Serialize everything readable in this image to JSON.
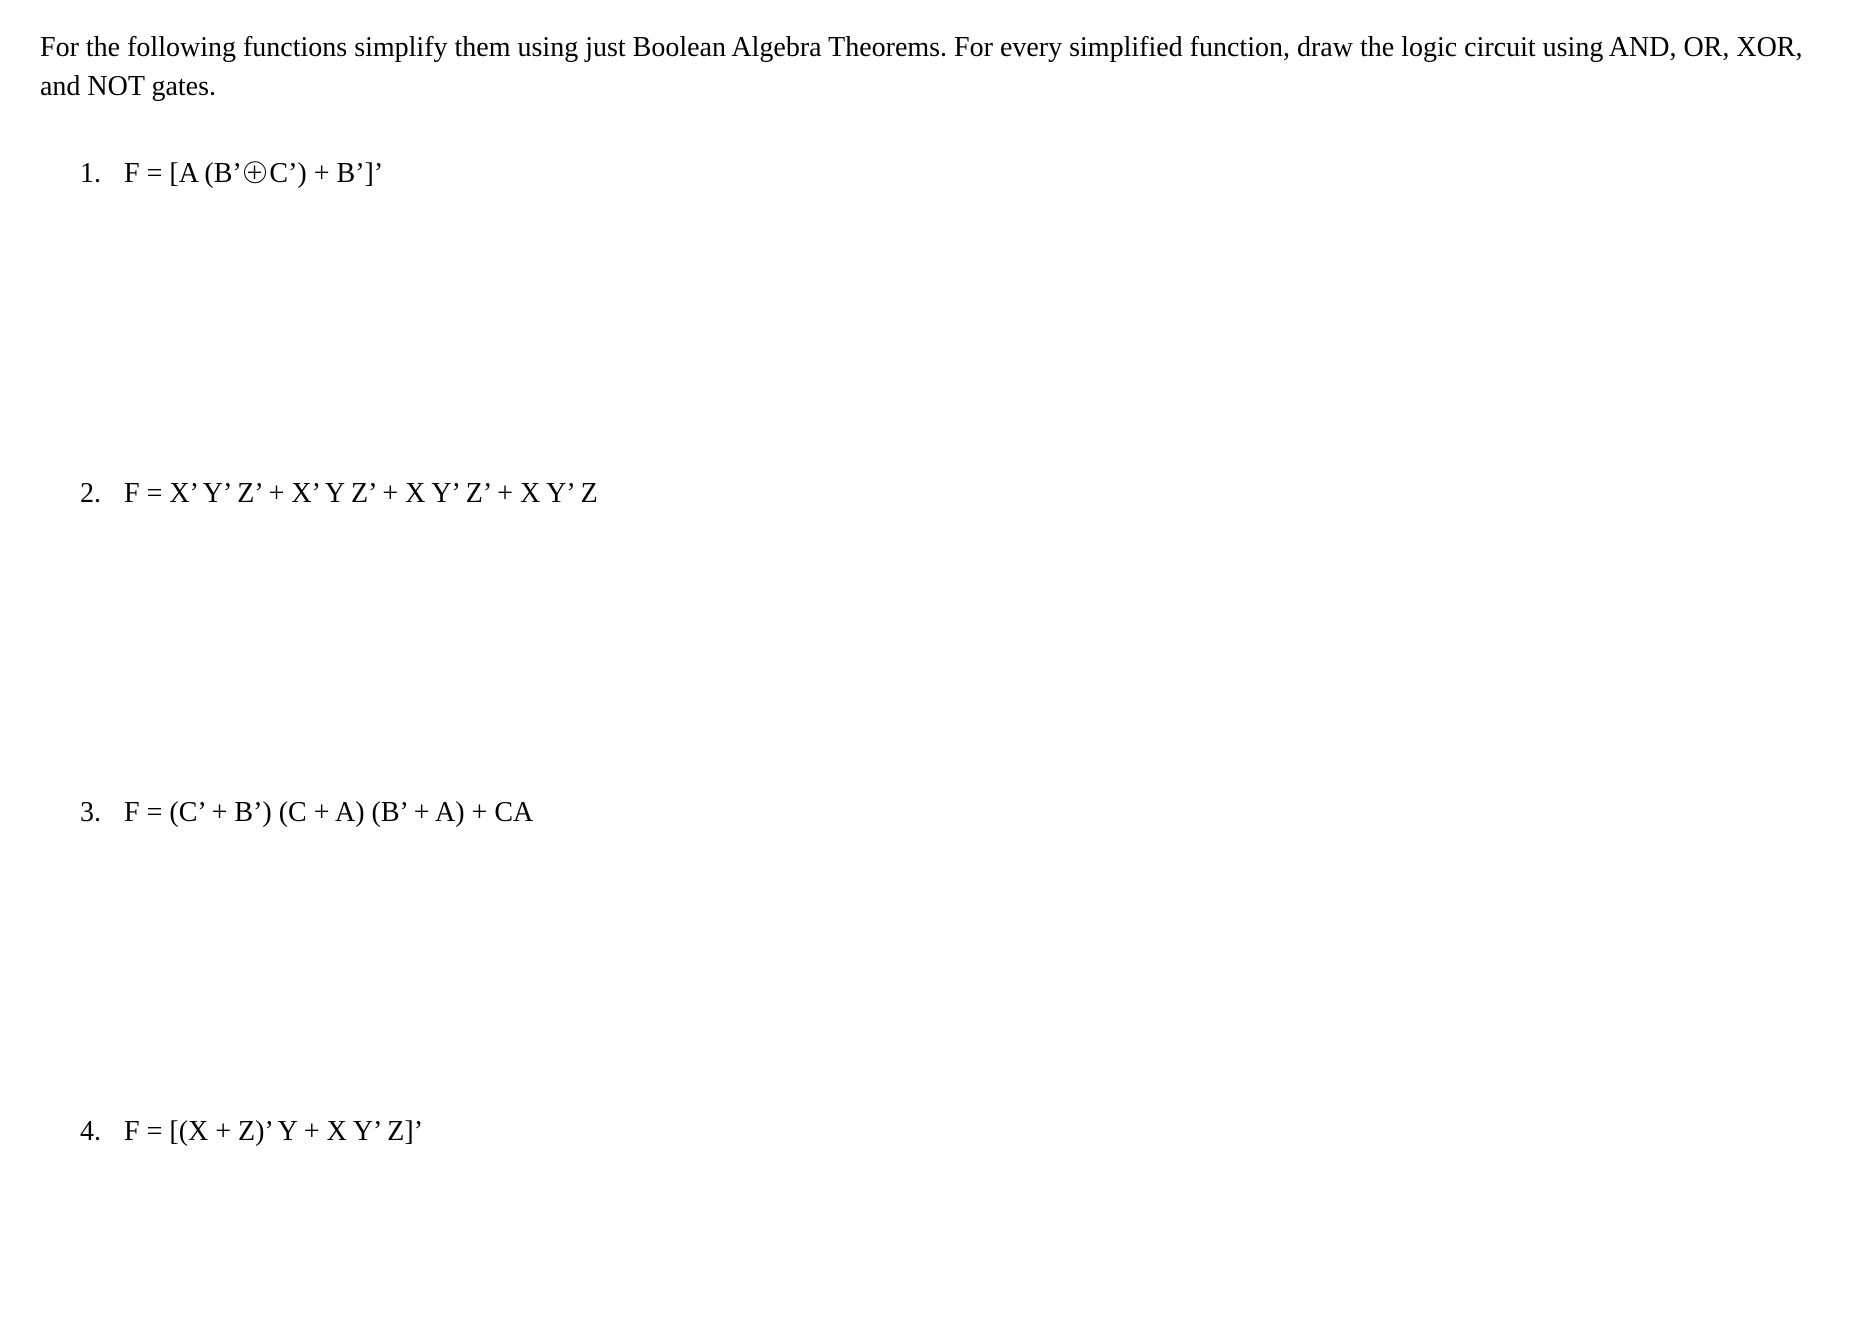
{
  "intro": "For the following functions simplify them using just Boolean Algebra Theorems. For every simplified function, draw the logic circuit using AND, OR, XOR, and NOT gates.",
  "problems": [
    {
      "number": "1.",
      "lhs": "F = [A (B’ ",
      "xor": "+",
      "rhs": " C’) + B’]’"
    },
    {
      "number": "2.",
      "eq": "F = X’ Y’ Z’ + X’ Y Z’ + X Y’ Z’ + X Y’ Z"
    },
    {
      "number": "3.",
      "eq": "F = (C’ + B’) (C + A) (B’ + A) + CA"
    },
    {
      "number": "4.",
      "eq": "F = [(X + Z)’ Y + X Y’ Z]’"
    }
  ]
}
